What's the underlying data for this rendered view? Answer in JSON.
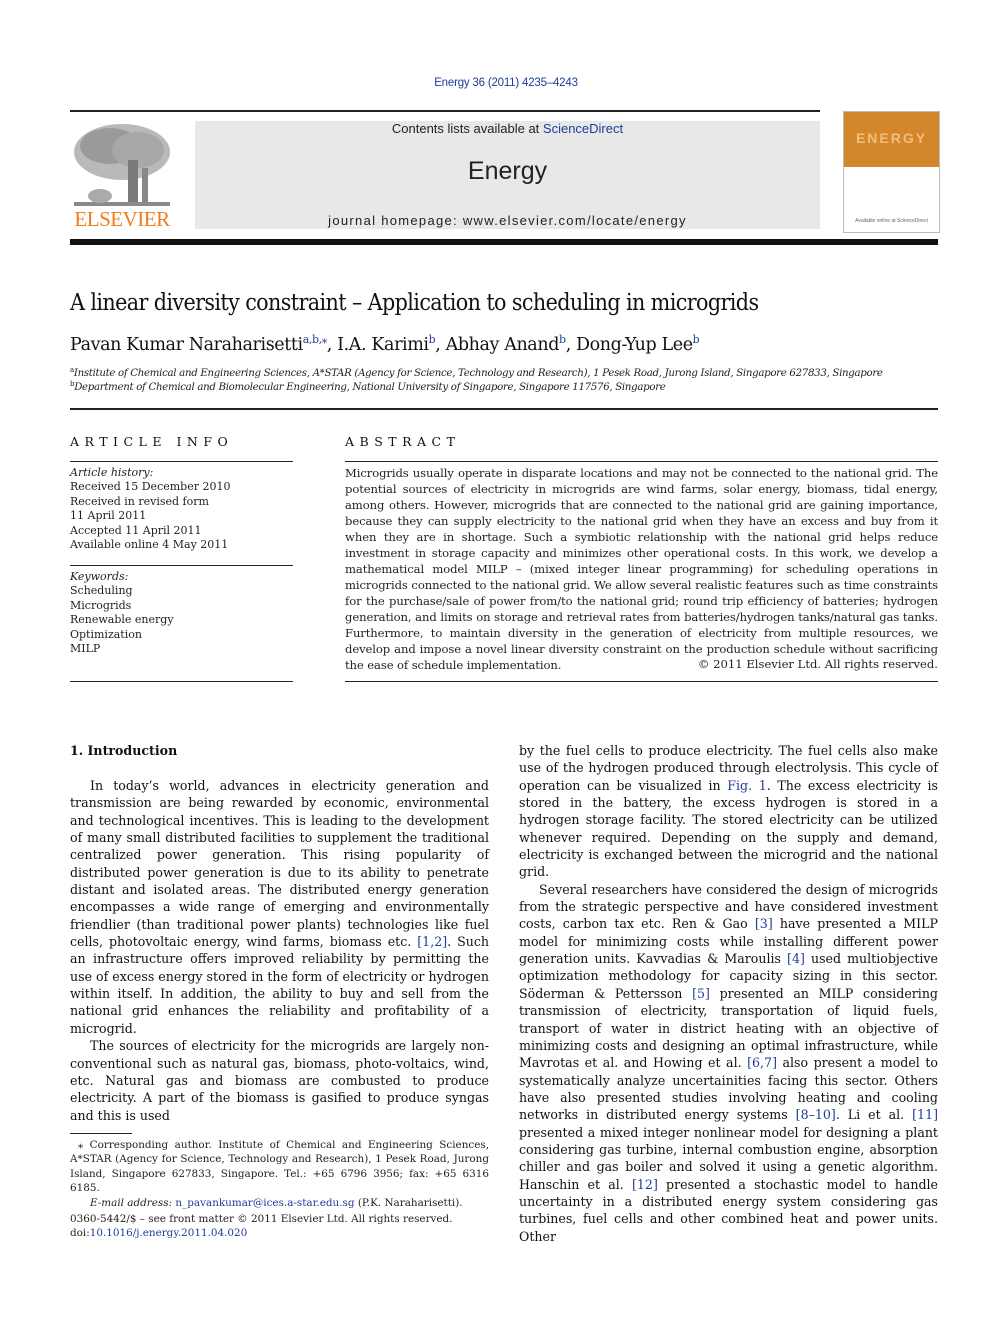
{
  "header": {
    "citation": "Energy 36 (2011) 4235–4243",
    "contents_prefix": "Contents lists available at ",
    "contents_link": "ScienceDirect",
    "journal_name": "Energy",
    "homepage": "journal homepage: www.elsevier.com/locate/energy",
    "publisher_logo": "ELSEVIER",
    "cover_title": "ENERGY",
    "cover_caption": "Available online at ScienceDirect",
    "colors": {
      "publisher_orange": "#f07c1b",
      "link_blue": "#1f3d99",
      "banner_gray": "#e8e8e8",
      "cover_orange": "#d4862a"
    }
  },
  "article": {
    "title": "A linear diversity constraint – Application to scheduling in microgrids",
    "authors": [
      {
        "name": "Pavan Kumar Naraharisetti",
        "sup": "a,b,⁎",
        "sep": ", "
      },
      {
        "name": "I.A. Karimi",
        "sup": "b",
        "sep": ", "
      },
      {
        "name": "Abhay Anand",
        "sup": "b",
        "sep": ", "
      },
      {
        "name": "Dong-Yup Lee",
        "sup": "b",
        "sep": ""
      }
    ],
    "affiliations": [
      {
        "mark": "a",
        "text": "Institute of Chemical and Engineering Sciences, A*STAR (Agency for Science, Technology and Research), 1 Pesek Road, Jurong Island, Singapore 627833, Singapore"
      },
      {
        "mark": "b",
        "text": "Department of Chemical and Biomolecular Engineering, National University of Singapore, Singapore 117576, Singapore"
      }
    ]
  },
  "article_info": {
    "heading": "ARTICLE INFO",
    "history_label": "Article history:",
    "history": [
      "Received 15 December 2010",
      "Received in revised form",
      "11 April 2011",
      "Accepted 11 April 2011",
      "Available online 4 May 2011"
    ],
    "keywords_label": "Keywords:",
    "keywords": [
      "Scheduling",
      "Microgrids",
      "Renewable energy",
      "Optimization",
      "MILP"
    ]
  },
  "abstract": {
    "heading": "ABSTRACT",
    "text": "Microgrids usually operate in disparate locations and may not be connected to the national grid. The potential sources of electricity in microgrids are wind farms, solar energy, biomass, tidal energy, among others. However, microgrids that are connected to the national grid are gaining importance, because they can supply electricity to the national grid when they have an excess and buy from it when they are in shortage. Such a symbiotic relationship with the national grid helps reduce investment in storage capacity and minimizes other operational costs. In this work, we develop a mathematical model MILP – (mixed integer linear programming) for scheduling operations in microgrids connected to the national grid. We allow several realistic features such as time constraints for the purchase/sale of power from/to the national grid; round trip efficiency of batteries; hydrogen generation, and limits on storage and retrieval rates from batteries/hydrogen tanks/natural gas tanks. Furthermore, to maintain diversity in the generation of electricity from multiple resources, we develop and impose a novel linear diversity constraint on the production schedule without sacrificing the ease of schedule implementation.",
    "copyright": "© 2011 Elsevier Ltd. All rights reserved."
  },
  "body": {
    "section_heading": "1.  Introduction",
    "left": {
      "p1_a": "In today’s world, advances in electricity generation and transmission are being rewarded by economic, environmental and technological incentives. This is leading to the development of many small distributed facilities to supplement the traditional centralized power generation. This rising popularity of distributed power generation is due to its ability to penetrate distant and isolated areas. The distributed energy generation encompasses a wide range of emerging and environmentally friendlier (than traditional power plants) technologies like fuel cells, photovoltaic energy, wind farms, biomass etc. ",
      "p1_ref": "[1,2]",
      "p1_b": ". Such an infrastructure offers improved reliability by permitting the use of excess energy stored in the form of electricity or hydrogen within itself. In addition, the ability to buy and sell from the national grid enhances the reliability and profitability of a microgrid.",
      "p2": "The sources of electricity for the microgrids are largely non-conventional such as natural gas, biomass, photo-voltaics, wind, etc. Natural gas and biomass are combusted to produce electricity. A part of the biomass is gasified to produce syngas and this is used"
    },
    "right": {
      "p1_a": "by the fuel cells to produce electricity. The fuel cells also make use of the hydrogen produced through electrolysis. This cycle of operation can be visualized in ",
      "p1_ref": "Fig. 1",
      "p1_b": ". The excess electricity is stored in the battery, the excess hydrogen is stored in a hydrogen storage facility. The stored electricity can be utilized whenever required. Depending on the supply and demand, electricity is exchanged between the microgrid and the national grid.",
      "p2_a": "Several researchers have considered the design of microgrids from the strategic perspective and have considered investment costs, carbon tax etc. Ren & Gao ",
      "ref3": "[3]",
      "p2_b": " have presented a MILP model for minimizing costs while installing different power generation units. Kavvadias & Maroulis ",
      "ref4": "[4]",
      "p2_c": " used multiobjective optimization methodology for capacity sizing in this sector. Söderman & Pettersson ",
      "ref5": "[5]",
      "p2_d": " presented an MILP considering transmission of electricity, transportation of liquid fuels, transport of water in district heating with an objective of minimizing costs and designing an optimal infrastructure, while Mavrotas et al. and Howing et al. ",
      "ref67": "[6,7]",
      "p2_e": " also present a model to systematically analyze uncertainities facing this sector. Others have also presented studies involving heating and cooling networks in distributed energy systems ",
      "ref810": "[8–10]",
      "p2_f": ". Li et al. ",
      "ref11": "[11]",
      "p2_g": " presented a mixed integer nonlinear model for designing a plant considering gas turbine, internal combustion engine, absorption chiller and gas boiler and solved it using a genetic algorithm. Hanschin et al. ",
      "ref12": "[12]",
      "p2_h": " presented a stochastic model to handle uncertainty in a distributed energy system considering gas turbines, fuel cells and other combined heat and power units. Other"
    }
  },
  "footnote": {
    "corresponding": "⁎ Corresponding author. Institute of Chemical and Engineering Sciences, A*STAR (Agency for Science, Technology and Research), 1 Pesek Road, Jurong Island, Singapore 627833, Singapore. Tel.: +65 6796 3956; fax: +65 6316 6185.",
    "email_label": "E-mail address:",
    "email": "n_pavankumar@ices.a-star.edu.sg",
    "email_owner": " (P.K. Naraharisetti)."
  },
  "front_matter": {
    "issn_line": "0360-5442/$ – see front matter © 2011 Elsevier Ltd. All rights reserved.",
    "doi_label": "doi:",
    "doi": "10.1016/j.energy.2011.04.020"
  }
}
